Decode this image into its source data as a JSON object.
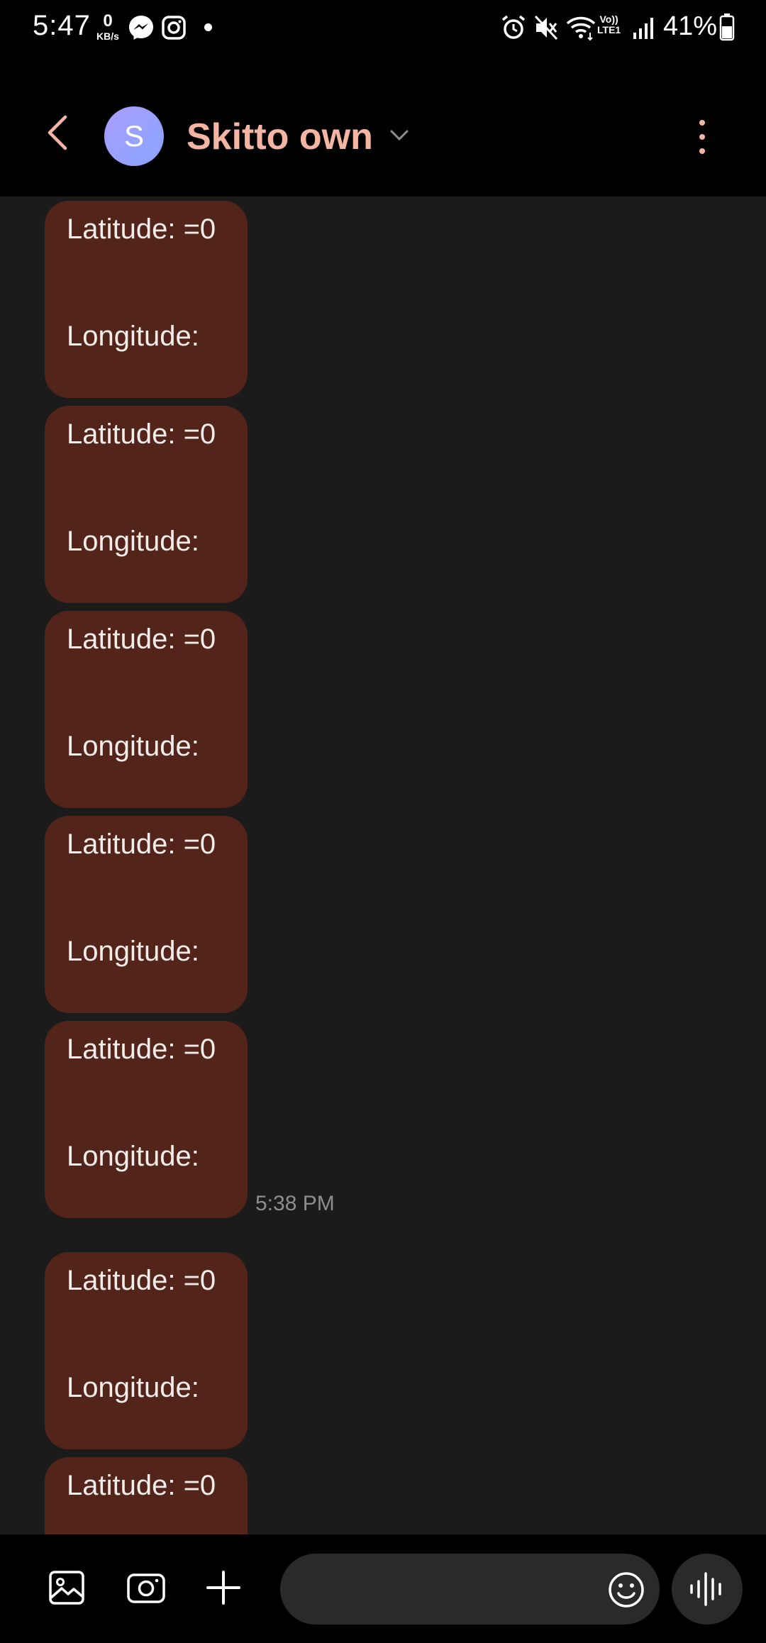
{
  "status_bar": {
    "time": "5:47",
    "net_speed_value": "0",
    "net_speed_unit": "KB/s",
    "volte_line1": "Vo))",
    "volte_line2": "LTE1",
    "battery_percent": "41%"
  },
  "header": {
    "avatar_initial": "S",
    "contact_name": "Skitto own"
  },
  "messages": [
    {
      "latitude": "Latitude: =0",
      "longitude": "Longitude:"
    },
    {
      "latitude": "Latitude: =0",
      "longitude": "Longitude:"
    },
    {
      "latitude": "Latitude: =0",
      "longitude": "Longitude:"
    },
    {
      "latitude": "Latitude: =0",
      "longitude": "Longitude:"
    },
    {
      "latitude": "Latitude: =0",
      "longitude": "Longitude:"
    },
    {
      "latitude": "Latitude: =0",
      "longitude": "Longitude:"
    },
    {
      "latitude": "Latitude: =0",
      "longitude": ""
    }
  ],
  "timestamp": "5:38 PM",
  "compose": {
    "placeholder": ""
  },
  "colors": {
    "accent": "#f4b5a3",
    "bubble": "#53241a",
    "chat_bg": "#1b1b1b"
  }
}
